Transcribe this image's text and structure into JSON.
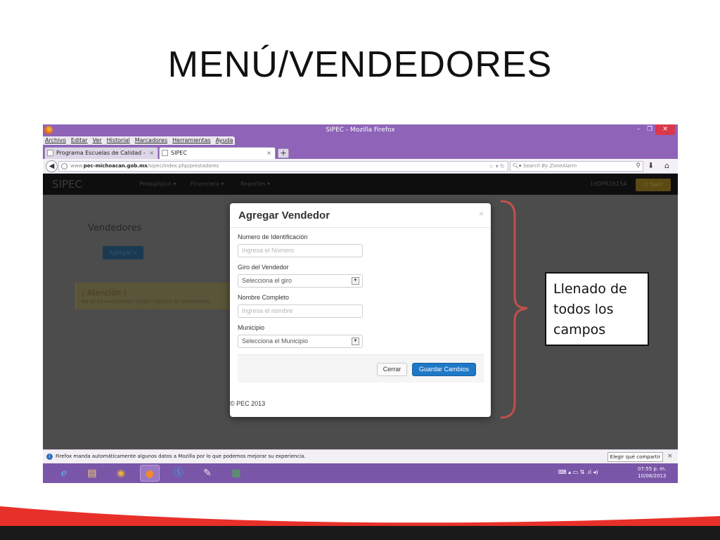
{
  "slide": {
    "title": "MENÚ/VENDEDORES"
  },
  "browser": {
    "window_title": "SIPEC - Mozilla Firefox",
    "menu": [
      "Archivo",
      "Editar",
      "Ver",
      "Historial",
      "Marcadores",
      "Herramientas",
      "Ayuda"
    ],
    "tabs": [
      {
        "label": "Programa Escuelas de Calidad - Inicio"
      },
      {
        "label": "SIPEC"
      }
    ],
    "url_prefix": "www.",
    "url_host": "pec-michoacan.gob.mx",
    "url_path": "/sipec/index.php/prestadores",
    "search_placeholder": "Search By ZoneAlarm"
  },
  "app": {
    "brand": "SIPEC",
    "menu": [
      "Pedagógico ▾",
      "Financiero ▾",
      "Reportes ▾"
    ],
    "user_code": "16DPR1615A",
    "logout_label": "⏻ Salir",
    "page_heading": "Vendedores",
    "add_button": "Agregar »",
    "alert_title": "¡ Atención !",
    "alert_text": "No se ha encontrado ningún registro de Vendedores"
  },
  "modal": {
    "title": "Agregar Vendedor",
    "close": "×",
    "fields": [
      {
        "label": "Numero de Identificación",
        "type": "input",
        "placeholder": "Ingresa el Número"
      },
      {
        "label": "Giro del Vendedor",
        "type": "select",
        "value": "Selecciona el giro"
      },
      {
        "label": "Nombre Completo",
        "type": "input",
        "placeholder": "Ingresa el nombre"
      },
      {
        "label": "Municipio",
        "type": "select",
        "value": "Selecciona el Municipio"
      }
    ],
    "cancel_label": "Cerrar",
    "save_label": "Guardar Cambios",
    "copyright": "© PEC 2013"
  },
  "callout": {
    "text": "Llenado de todos los campos",
    "lines": [
      "Llenado de",
      "todos los",
      "campos"
    ],
    "color": "#c0504d"
  },
  "notification": {
    "text": "Firefox manda automáticamente algunos datos a Mozilla por lo que podemos mejorar su experiencia.",
    "button": "Elegir qué compartir",
    "close": "×"
  },
  "taskbar": {
    "items": [
      "ie-icon",
      "explorer-icon",
      "chrome-icon",
      "firefox-icon",
      "skype-icon",
      "paint-icon",
      "excel-icon"
    ],
    "time": "07:55 p. m.",
    "date": "10/06/2013"
  },
  "colors": {
    "firefox_purple": "#8e63b8",
    "save_blue": "#1f78c7",
    "bracket_red": "#c0504d",
    "footer_red": "#e8302a"
  }
}
